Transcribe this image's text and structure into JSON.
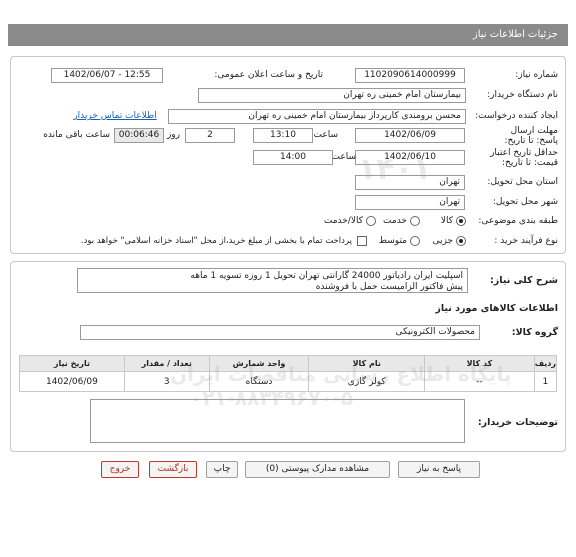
{
  "header": {
    "title": "جزئیات اطلاعات نیاز"
  },
  "fields": {
    "need_number_label": "شماره نیاز:",
    "need_number": "1102090614000999",
    "announce_label": "تاریخ و ساعت اعلان عمومی:",
    "announce_value": "1402/06/07 - 12:55",
    "buyer_org_label": "نام دستگاه خریدار:",
    "buyer_org": "بیمارستان امام خمینی ره  تهران",
    "creator_label": "ایجاد کننده درخواست:",
    "creator": "محسن برومندی کارپرداز بیمارستان امام خمینی ره  تهران",
    "contact_link": "اطلاعات تماس خریدار",
    "reply_deadline_label": "مهلت ارسال پاسخ: تا تاریخ:",
    "reply_date": "1402/06/09",
    "time_label": "ساعت",
    "reply_time": "13:10",
    "days_value": "2",
    "days_label": "روز و",
    "remaining_value": "00:06:46",
    "remaining_label": "ساعت باقی مانده",
    "validity_label": "حداقل تاریخ اعتبار قیمت: تا تاریخ:",
    "validity_date": "1402/06/10",
    "validity_time": "14:00",
    "province_label": "استان محل تحویل:",
    "province": "تهران",
    "city_label": "شهر محل تحویل:",
    "city": "تهران",
    "category_label": "طبقه بندی موضوعی:",
    "category_options": [
      "کالا",
      "خدمت",
      "کالا/خدمت"
    ],
    "process_label": "نوع فرآیند خرید :",
    "process_options": [
      "جزیی",
      "متوسط"
    ],
    "payment_note": "پرداخت تمام یا بخشی از مبلغ خرید،از محل \"اسناد خزانه اسلامی\" خواهد بود."
  },
  "summary": {
    "label": "شرح کلی نیاز:",
    "line1": "اسپلیت ایران رادیاتور 24000 گارانتی تهران تحویل 1 روزه تسویه 1 ماهه",
    "line2": "پیش فاکتور الزامیست حمل با فروشنده"
  },
  "goods": {
    "section_title": "اطلاعات کالاهای مورد نیاز",
    "group_label": "گروه کالا:",
    "group_value": "محصولات الکترونیکی",
    "columns": [
      "ردیف",
      "کد کالا",
      "نام کالا",
      "واحد شمارش",
      "تعداد / مقدار",
      "تاریخ نیاز"
    ],
    "rows": [
      {
        "row": "1",
        "code": "--",
        "name": "کولر گازی",
        "unit": "دستگاه",
        "qty": "3",
        "date": "1402/06/09"
      }
    ]
  },
  "buyer_notes": {
    "label": "توضیحات خریدار:",
    "value": ""
  },
  "buttons": {
    "reply": "پاسخ به نیاز",
    "attachments": "مشاهده مدارک پیوستی (0)",
    "print": "چاپ",
    "back": "بازگشت",
    "exit": "خروج"
  },
  "watermark": {
    "line1": "پایگاه اطلاع رسانی مناقصات ایران",
    "line2": "۰۲۱-۸۸۳۴۹۶۷۰-۵",
    "line3": "۱۴۰۱"
  }
}
